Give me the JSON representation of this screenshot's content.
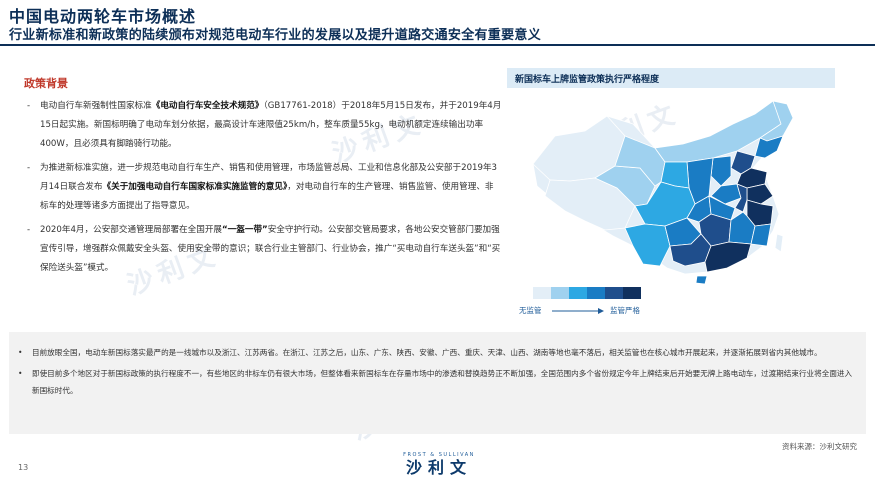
{
  "header": {
    "title": "中国电动两轮车市场概述",
    "subtitle": "行业新标准和新政策的陆续颁布对规范电动车行业的发展以及提升道路交通安全有重要意义"
  },
  "policy": {
    "section_title": "政策背景",
    "bullet": "-",
    "items": [
      {
        "pre": "电动自行车新强制性国家标准",
        "bold": "《电动自行车安全技术规范》",
        "post": "（GB17761-2018）于2018年5月15日发布，并于2019年4月15日起实施。新国标明确了电动车划分依据，最高设计车速限值25km/h，整车质量55kg，电动机额定连续输出功率400W，且必须具有脚踏骑行功能。"
      },
      {
        "pre": "为推进新标准实施，进一步规范电动自行车生产、销售和使用管理，市场监管总局、工业和信息化部及公安部于2019年3月14日联合发布",
        "bold": "《关于加强电动自行车国家标准实施监管的意见》",
        "post": "，对电动自行车的生产管理、销售监管、使用管理、非标车的处理等诸多方面提出了指导意见。"
      },
      {
        "pre": "2020年4月，公安部交通管理局部署在全国开展",
        "bold": "“一盔一带”",
        "post": "安全守护行动。公安部交管局要求，各地公安交管部门要加强宣传引导，增强群众佩戴安全头盔、使用安全带的意识；联合行业主管部门、行业协会，推广“买电动自行车送头盔”和“买保险送头盔”模式。"
      }
    ]
  },
  "map": {
    "title": "新国标车上牌监管政策执行严格程度",
    "legend_low": "无监管",
    "legend_high": "监管严格",
    "scale_colors": [
      "#e3eef7",
      "#9fd1ef",
      "#2da8e3",
      "#1a7cc4",
      "#1f4e8c",
      "#10305e"
    ],
    "outline_color": "#bcd9ee"
  },
  "notes": {
    "bullet": "•",
    "items": [
      "目前放眼全国，电动车新国标落实最严的是一线城市以及浙江、江苏两省。在浙江、江苏之后，山东、广东、陕西、安徽、广西、重庆、天津、山西、湖南等地也毫不落后，相关监管也在核心城市开展起来，并逐渐拓展到省内其他城市。",
      "即使目前多个地区对于新国标政策的执行程度不一，有些地区的非标车仍有很大市场，但整体看来新国标车在存量市场中的渗透和替换趋势正不断加强，全国范围内多个省份规定今年上牌结束后开始要无牌上路电动车，过渡期结束行业将全面进入新国标时代。"
    ]
  },
  "footer": {
    "source": "资料来源：沙利文研究",
    "page_number": "13",
    "logo_en": "FROST & SULLIVAN",
    "logo_cn": "沙利文"
  },
  "watermark": {
    "text": "沙利文"
  }
}
